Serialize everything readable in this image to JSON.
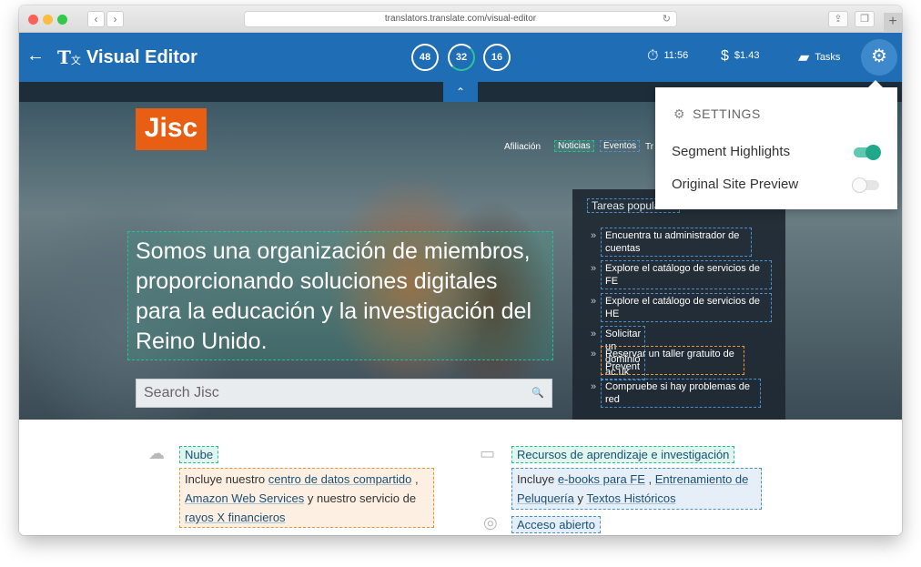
{
  "browser": {
    "url": "translators.translate.com/visual-editor",
    "back_glyph": "‹",
    "forward_glyph": "›"
  },
  "header": {
    "back_glyph": "←",
    "logo_glyph": "T",
    "logo_sub": "文",
    "title": "Visual Editor",
    "counters": [
      "48",
      "32",
      "16"
    ],
    "timer": "11:56",
    "earnings": "$1.43",
    "tasks_label": "Tasks"
  },
  "settings": {
    "title": "SETTINGS",
    "segment_highlights_label": "Segment Highlights",
    "segment_highlights_on": true,
    "original_preview_label": "Original Site Preview",
    "original_preview_on": false
  },
  "site": {
    "logo": "Jisc",
    "nav": [
      "Afiliación",
      "Noticias",
      "Eventos",
      "Tr"
    ],
    "headline": "Somos una organización de miembros, proporcionando soluciones digitales para la educación y la investigación del Reino Unido.",
    "search_placeholder": "Search Jisc",
    "sidebar": {
      "title": "Tareas populares",
      "items": [
        "Encuentra tu administrador de cuentas",
        "Explore el catálogo de servicios de FE",
        "Explore el catálogo de servicios de HE",
        "Solicitar un dominio ac.uk",
        "Reservar un taller gratuito de Prevent",
        "Compruebe si hay problemas de red"
      ]
    }
  },
  "lower": {
    "left": {
      "title": "Nube",
      "text_1": "Incluye nuestro ",
      "link_1": "centro de datos compartido",
      "text_2": " ,",
      "link_2": "Amazon Web Services",
      "text_3": " y nuestro servicio de",
      "link_3": "rayos X financieros"
    },
    "right": {
      "title": "Recursos de aprendizaje e investigación",
      "text_1": "Incluye ",
      "link_1": "e-books para FE",
      "text_2": " , ",
      "link_2": "Entrenamiento de",
      "link_3": "Peluquería",
      "text_3": " y ",
      "link_4": "Textos Históricos",
      "title_2": "Acceso abierto"
    }
  },
  "colors": {
    "brand_blue": "#1e6db5",
    "jisc_orange": "#e85e13",
    "highlight_green": "#26c08f",
    "highlight_blue": "#4b8fd0",
    "highlight_orange": "#f0943a"
  }
}
